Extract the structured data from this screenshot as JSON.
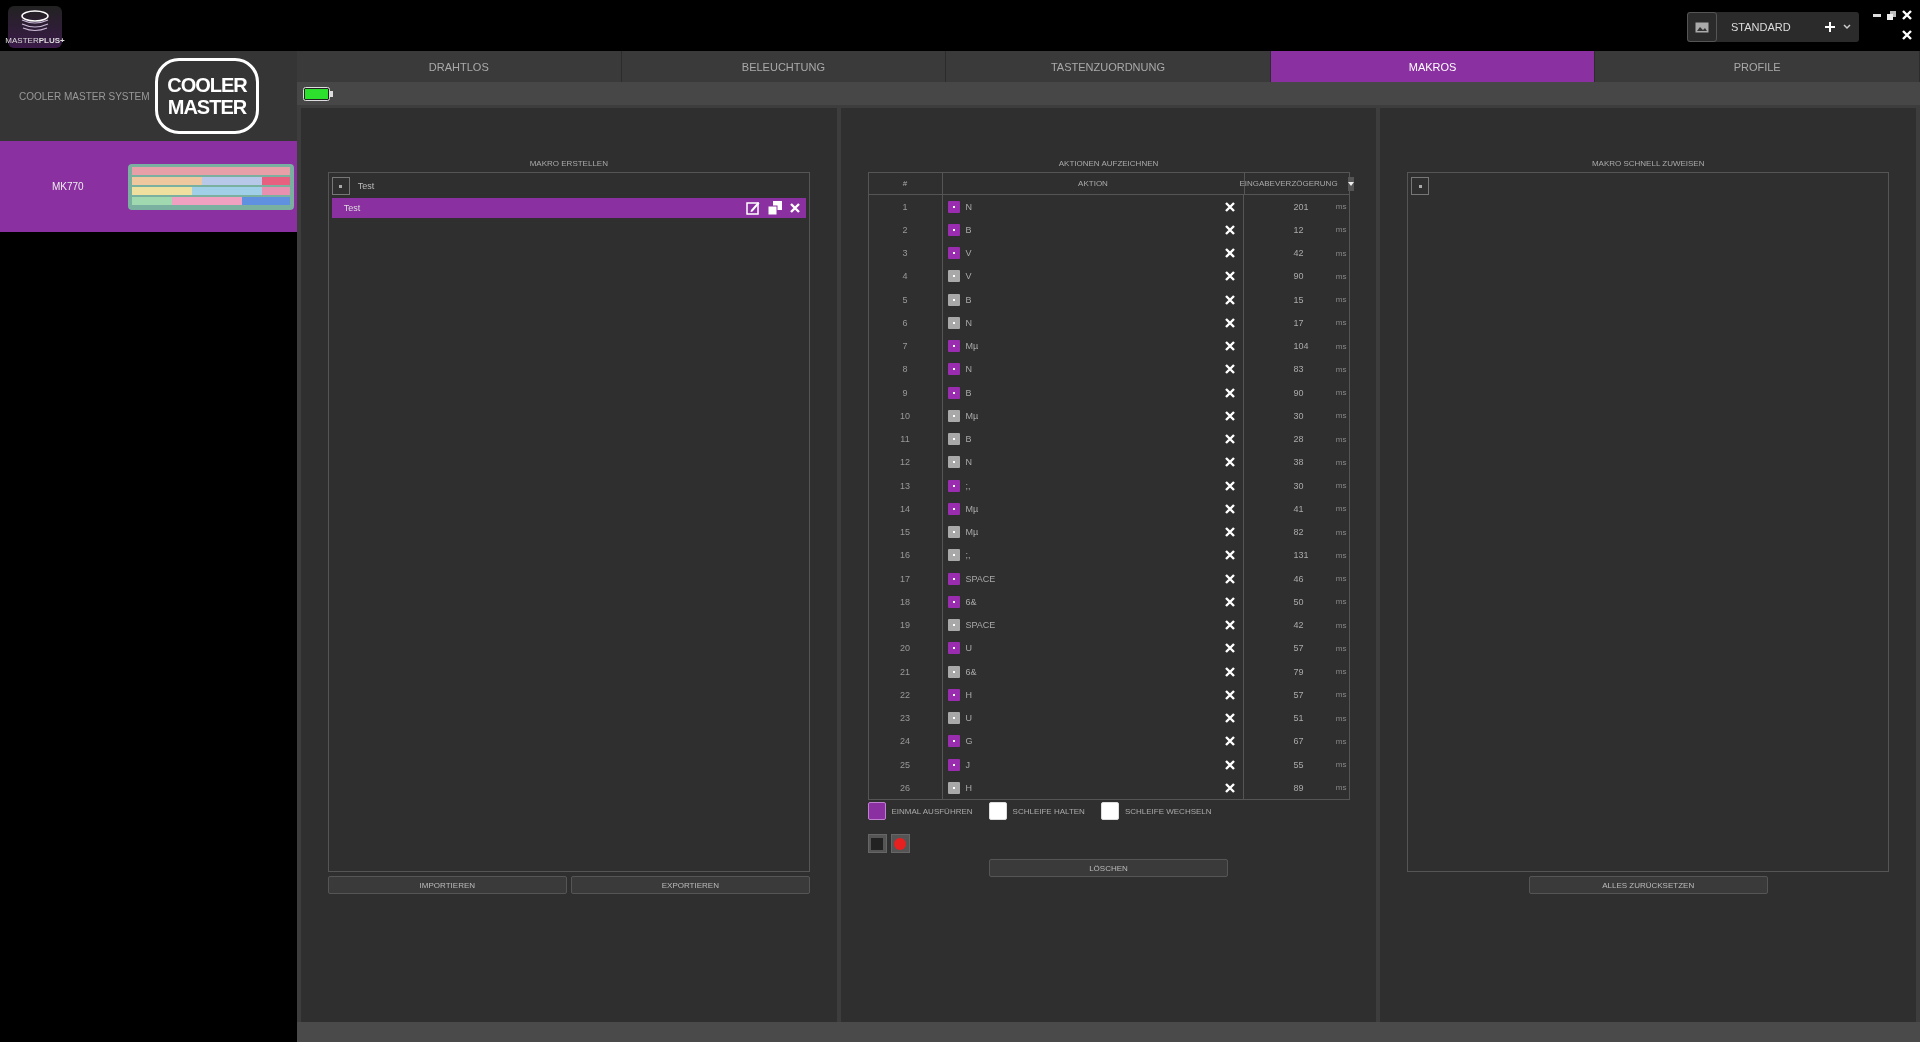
{
  "app": {
    "badge": "MASTER**PLUS+**"
  },
  "profile": {
    "name": "STANDARD"
  },
  "sidebar": {
    "system": {
      "label": "COOLER MASTER SYSTEM",
      "logo": [
        "COOLER",
        "MASTER"
      ]
    },
    "devices": [
      {
        "name": "MK770",
        "selected": true
      }
    ]
  },
  "tabs": [
    {
      "label": "DRAHTLOS",
      "selected": false
    },
    {
      "label": "BELEUCHTUNG",
      "selected": false
    },
    {
      "label": "TASTENZUORDNUNG",
      "selected": false
    },
    {
      "label": "MAKROS",
      "selected": true
    },
    {
      "label": "PROFILE",
      "selected": false
    }
  ],
  "macro_create": {
    "title": "MAKRO ERSTELLEN",
    "new_name": "Test",
    "macros": [
      {
        "name": "Test",
        "selected": true
      }
    ],
    "buttons": [
      "IMPORTIEREN",
      "EXPORTIEREN"
    ]
  },
  "record": {
    "title": "AKTIONEN AUFZEICHNEN",
    "columns": [
      "#",
      "AKTION",
      "EINGABEVERZÖGERUNG"
    ],
    "rows": [
      {
        "index": "1",
        "pressed": true,
        "key": "N",
        "delay": "201",
        "unit": "ms"
      },
      {
        "index": "2",
        "pressed": true,
        "key": "B",
        "delay": "12",
        "unit": "ms"
      },
      {
        "index": "3",
        "pressed": true,
        "key": "V",
        "delay": "42",
        "unit": "ms"
      },
      {
        "index": "4",
        "pressed": false,
        "key": "V",
        "delay": "90",
        "unit": "ms"
      },
      {
        "index": "5",
        "pressed": false,
        "key": "B",
        "delay": "15",
        "unit": "ms"
      },
      {
        "index": "6",
        "pressed": false,
        "key": "N",
        "delay": "17",
        "unit": "ms"
      },
      {
        "index": "7",
        "pressed": true,
        "key": "Mµ",
        "delay": "104",
        "unit": "ms"
      },
      {
        "index": "8",
        "pressed": true,
        "key": "N",
        "delay": "83",
        "unit": "ms"
      },
      {
        "index": "9",
        "pressed": true,
        "key": "B",
        "delay": "90",
        "unit": "ms"
      },
      {
        "index": "10",
        "pressed": false,
        "key": "Mµ",
        "delay": "30",
        "unit": "ms"
      },
      {
        "index": "11",
        "pressed": false,
        "key": "B",
        "delay": "28",
        "unit": "ms"
      },
      {
        "index": "12",
        "pressed": false,
        "key": "N",
        "delay": "38",
        "unit": "ms"
      },
      {
        "index": "13",
        "pressed": true,
        "key": ";,",
        "delay": "30",
        "unit": "ms"
      },
      {
        "index": "14",
        "pressed": true,
        "key": "Mµ",
        "delay": "41",
        "unit": "ms"
      },
      {
        "index": "15",
        "pressed": false,
        "key": "Mµ",
        "delay": "82",
        "unit": "ms"
      },
      {
        "index": "16",
        "pressed": false,
        "key": ";,",
        "delay": "131",
        "unit": "ms"
      },
      {
        "index": "17",
        "pressed": true,
        "key": "SPACE",
        "delay": "46",
        "unit": "ms"
      },
      {
        "index": "18",
        "pressed": true,
        "key": "6&",
        "delay": "50",
        "unit": "ms"
      },
      {
        "index": "19",
        "pressed": false,
        "key": "SPACE",
        "delay": "42",
        "unit": "ms"
      },
      {
        "index": "20",
        "pressed": true,
        "key": "U",
        "delay": "57",
        "unit": "ms"
      },
      {
        "index": "21",
        "pressed": false,
        "key": "6&",
        "delay": "79",
        "unit": "ms"
      },
      {
        "index": "22",
        "pressed": true,
        "key": "H",
        "delay": "57",
        "unit": "ms"
      },
      {
        "index": "23",
        "pressed": false,
        "key": "U",
        "delay": "51",
        "unit": "ms"
      },
      {
        "index": "24",
        "pressed": true,
        "key": "G",
        "delay": "67",
        "unit": "ms"
      },
      {
        "index": "25",
        "pressed": true,
        "key": "J",
        "delay": "55",
        "unit": "ms"
      },
      {
        "index": "26",
        "pressed": false,
        "key": "H",
        "delay": "89",
        "unit": "ms"
      }
    ],
    "loop_modes": [
      {
        "label": "EINMAL AUSFÜHREN",
        "selected": true
      },
      {
        "label": "SCHLEIFE HALTEN",
        "selected": false
      },
      {
        "label": "SCHLEIFE WECHSELN",
        "selected": false
      }
    ],
    "clear_button": "LÖSCHEN"
  },
  "quick_assign": {
    "title": "MAKRO SCHNELL ZUWEISEN",
    "reset_button": "ALLES ZURÜCKSETZEN"
  }
}
